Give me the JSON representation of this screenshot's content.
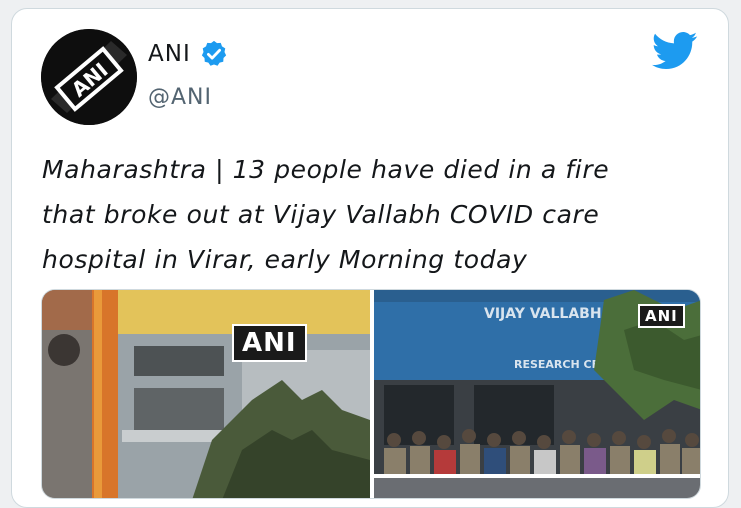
{
  "author": {
    "display_name": "ANI",
    "handle": "@ANI",
    "verified": true,
    "avatar_logo_text": "ANI"
  },
  "platform_icon": "twitter-bird-icon",
  "colors": {
    "twitter_blue": "#1d9bf0",
    "text": "#14171a",
    "secondary_text": "#536471"
  },
  "tweet": {
    "lines": [
      "Maharashtra | 13 people have died in a fire",
      "that broke out at Vijay Vallabh COVID care",
      "hospital in Virar, early Morning today"
    ]
  },
  "media": {
    "photo_1_watermark": "ANI",
    "photo_2_watermark": "ANI",
    "photo_2_sign_text": "VIJAY VALLABH",
    "photo_2_sign_text_2": "RESEARCH CENTER"
  }
}
